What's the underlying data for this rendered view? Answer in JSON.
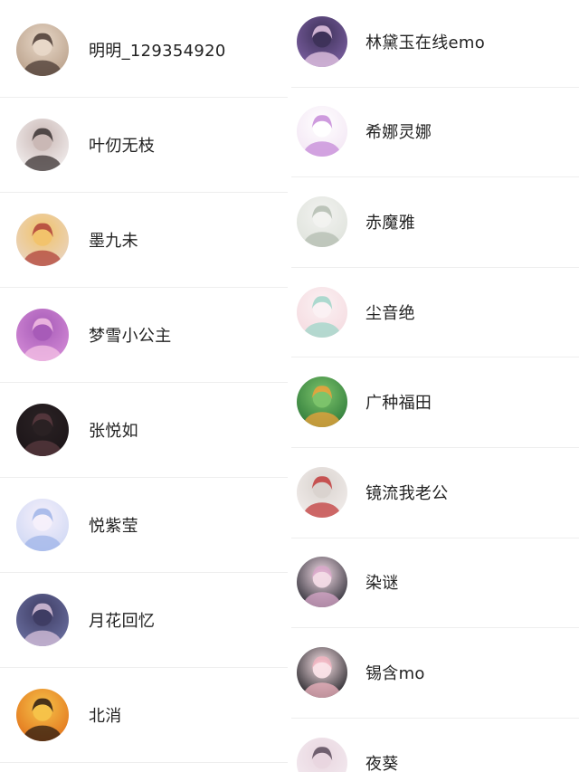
{
  "left_column": {
    "users": [
      {
        "name": "明明_129354920",
        "avatar_icon": "user-avatar-icon",
        "colors": [
          "#b9a08a",
          "#4a3a33",
          "#e8d8c8"
        ]
      },
      {
        "name": "叶仞无枝",
        "avatar_icon": "user-avatar-icon",
        "colors": [
          "#f2eeee",
          "#3b3333",
          "#c9b7b4"
        ]
      },
      {
        "name": "墨九未",
        "avatar_icon": "user-avatar-icon",
        "colors": [
          "#e9d4c2",
          "#b0413a",
          "#f1c36a"
        ]
      },
      {
        "name": "梦雪小公主",
        "avatar_icon": "user-avatar-icon",
        "colors": [
          "#d38ad6",
          "#f4c1e4",
          "#a65bb7"
        ]
      },
      {
        "name": "张悦如",
        "avatar_icon": "user-avatar-icon",
        "colors": [
          "#1c1518",
          "#5a3a3f",
          "#2a2224"
        ]
      },
      {
        "name": "悦紫莹",
        "avatar_icon": "user-avatar-icon",
        "colors": [
          "#cfd8f4",
          "#9fb4e8",
          "#f6f0fb"
        ]
      },
      {
        "name": "月花回忆",
        "avatar_icon": "user-avatar-icon",
        "colors": [
          "#6a6fa0",
          "#d9c3dc",
          "#3e3c63"
        ]
      },
      {
        "name": "北消",
        "avatar_icon": "user-avatar-icon",
        "colors": [
          "#e2731c",
          "#2a1a12",
          "#f6c34a"
        ]
      }
    ]
  },
  "right_column": {
    "users": [
      {
        "name": "林黛玉在线emo",
        "avatar_icon": "user-avatar-icon",
        "colors": [
          "#7b5fa1",
          "#e8c9e6",
          "#3d3158"
        ]
      },
      {
        "name": "希娜灵娜",
        "avatar_icon": "user-avatar-icon",
        "colors": [
          "#f3e6f4",
          "#c58ad8",
          "#ffffff"
        ]
      },
      {
        "name": "赤魔雅",
        "avatar_icon": "user-avatar-icon",
        "colors": [
          "#dfe3dc",
          "#b3bcb0",
          "#f2f2f0"
        ]
      },
      {
        "name": "尘音绝",
        "avatar_icon": "user-avatar-icon",
        "colors": [
          "#f5dbe0",
          "#9ed5c8",
          "#fbf1f3"
        ]
      },
      {
        "name": "广种福田",
        "avatar_icon": "user-avatar-icon",
        "colors": [
          "#2e7a3a",
          "#f0a13a",
          "#7dc46b"
        ]
      },
      {
        "name": "镜流我老公",
        "avatar_icon": "user-avatar-icon",
        "colors": [
          "#f1ecea",
          "#c23b3b",
          "#d9d3cf"
        ]
      },
      {
        "name": "染谜",
        "avatar_icon": "user-avatar-icon",
        "colors": [
          "#2a2a33",
          "#d8a7c9",
          "#f3dbe6"
        ]
      },
      {
        "name": "锡含mo",
        "avatar_icon": "user-avatar-icon",
        "colors": [
          "#1f1f24",
          "#f0b4c0",
          "#fbe3e8"
        ]
      },
      {
        "name": "夜葵",
        "avatar_icon": "user-avatar-icon",
        "colors": [
          "#f3eaf0",
          "#5a4a5a",
          "#e9d6df"
        ]
      }
    ]
  }
}
